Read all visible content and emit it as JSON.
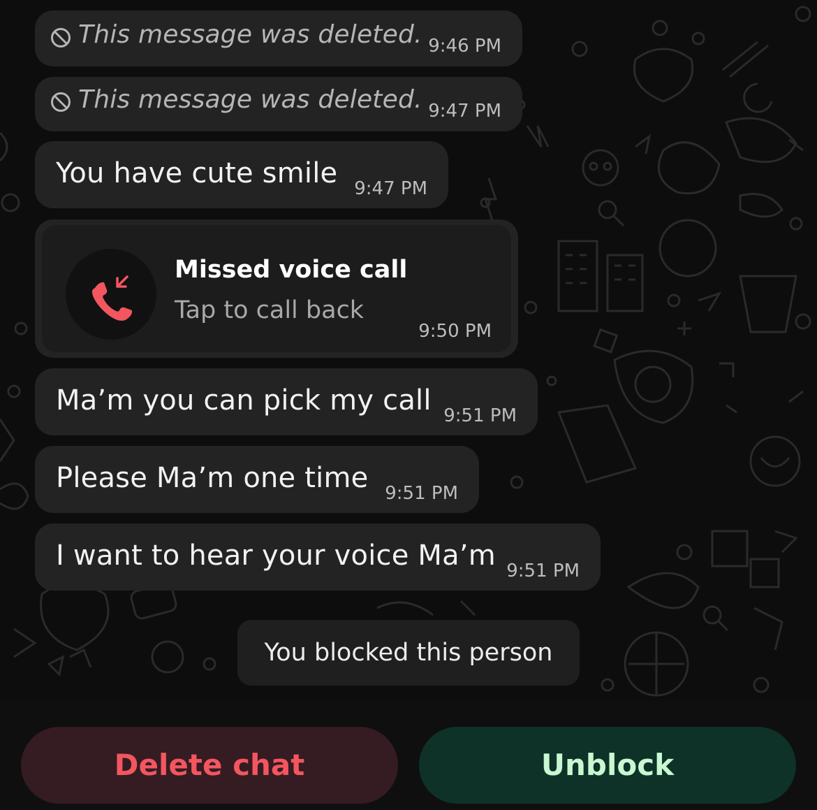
{
  "messages": [
    {
      "text": "This message was deleted.",
      "time": "9:46 PM",
      "deleted": true
    },
    {
      "text": "This message was deleted.",
      "time": "9:47 PM",
      "deleted": true
    },
    {
      "text": "You have cute smile",
      "time": "9:47 PM"
    },
    {
      "type": "call",
      "title": "Missed voice call",
      "subtitle": "Tap to call back",
      "time": "9:50 PM"
    },
    {
      "text": "Ma’m you can pick my call",
      "time": "9:51 PM"
    },
    {
      "text": "Please Ma’m one time",
      "time": "9:51 PM"
    },
    {
      "text": "I want to hear your voice Ma’m",
      "time": "9:51 PM"
    }
  ],
  "system_notice": "You blocked this person",
  "actions": {
    "delete_label": "Delete chat",
    "unblock_label": "Unblock"
  },
  "icons": {
    "deleted": "ban-icon",
    "missed_call": "missed-call-icon"
  },
  "colors": {
    "delete_text": "#f2565f",
    "unblock_text": "#c9f7d2",
    "missed_call_icon": "#f2565f"
  }
}
